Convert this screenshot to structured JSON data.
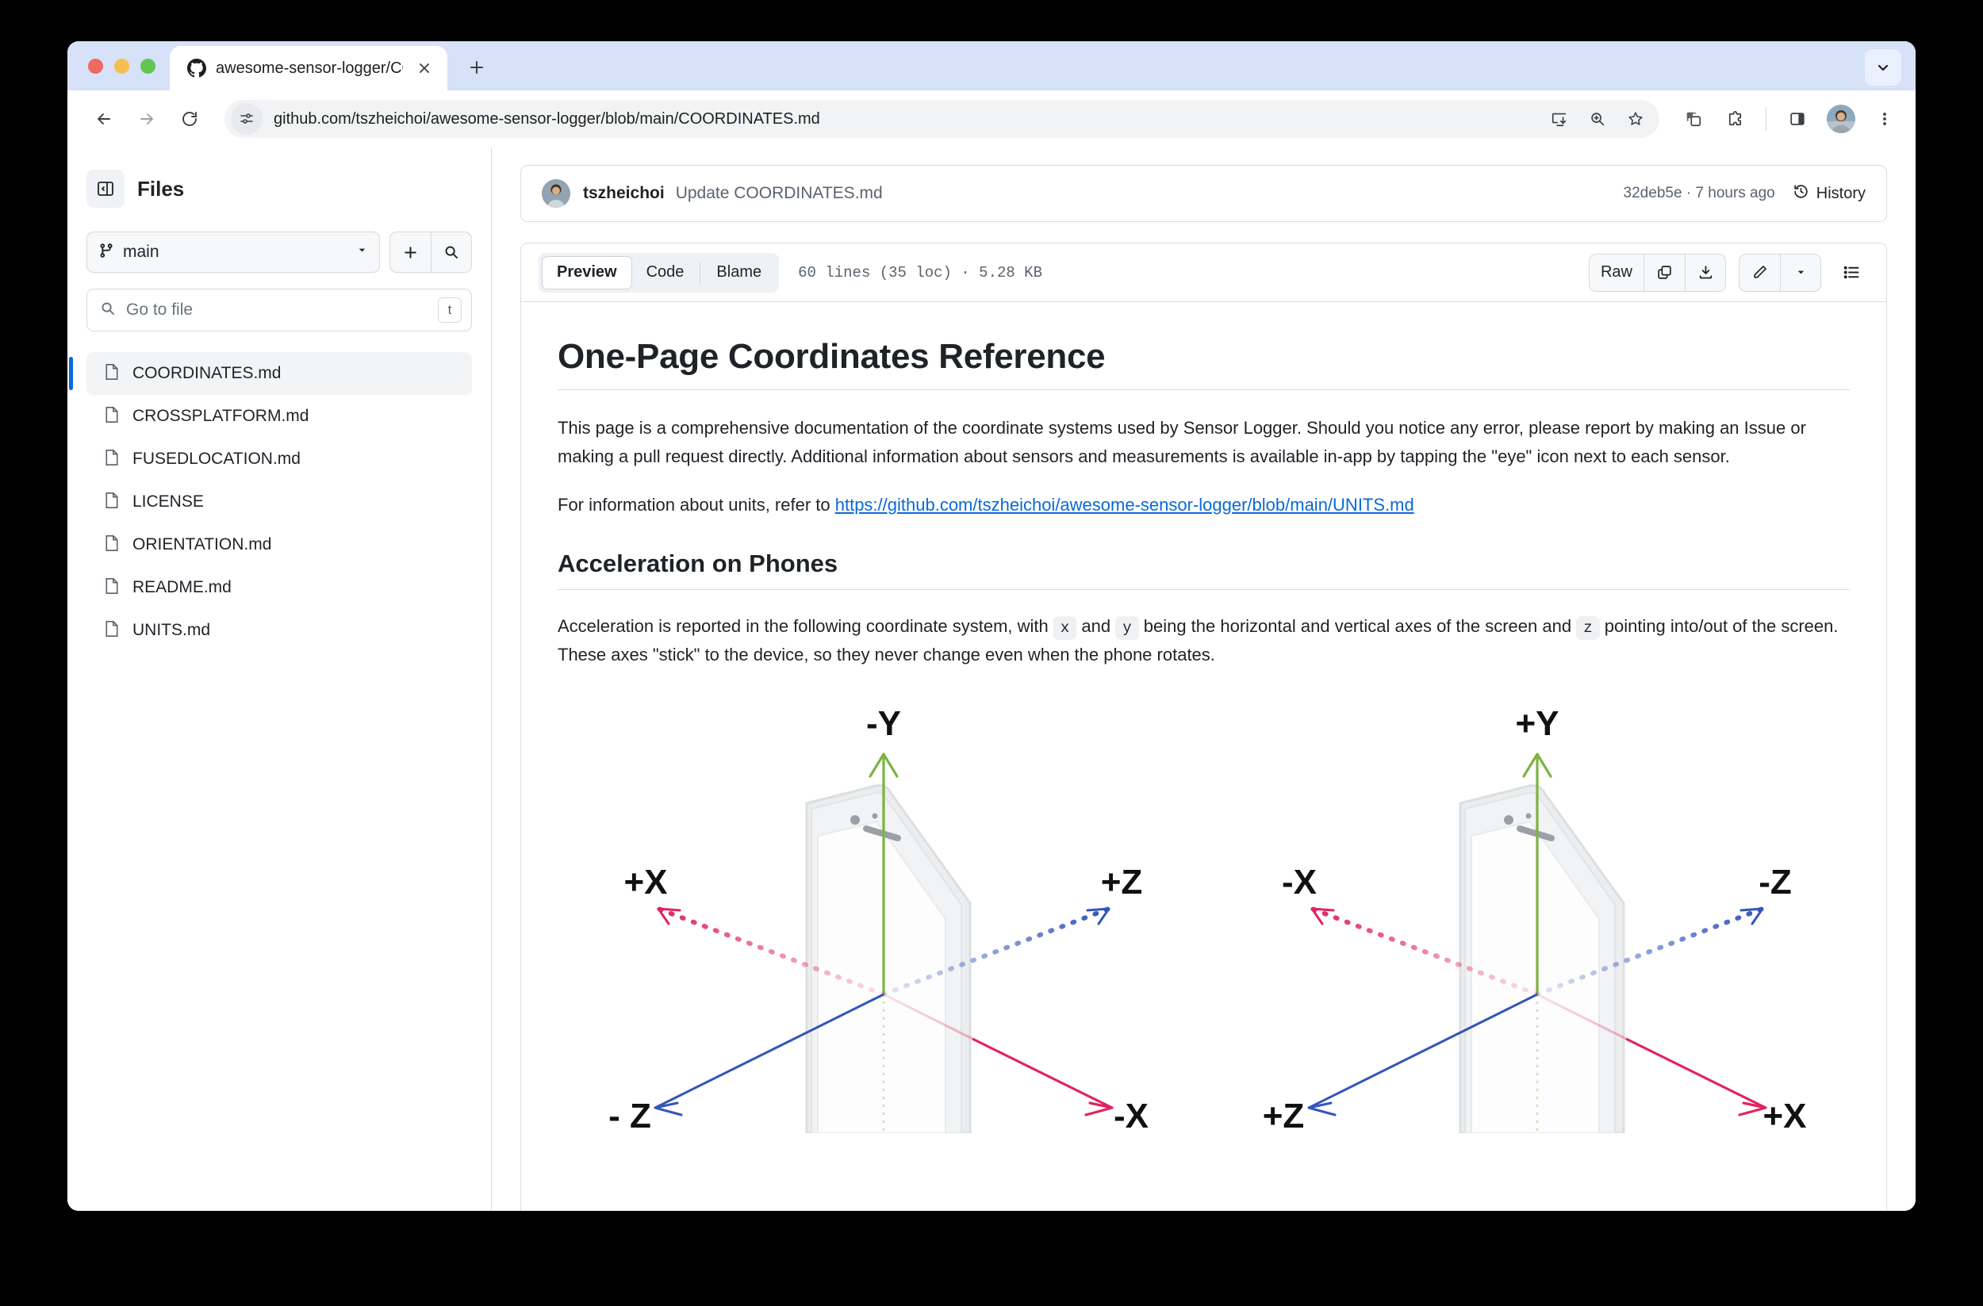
{
  "browser": {
    "tab": {
      "title": "awesome-sensor-logger/COO",
      "favicon_icon": "github-icon",
      "close_icon": "close-icon"
    },
    "new_tab_icon": "plus-icon",
    "tab_search_icon": "chevron-down-icon",
    "nav": {
      "back_icon": "back-arrow-icon",
      "forward_icon": "forward-arrow-icon",
      "reload_icon": "reload-icon"
    },
    "omnibox": {
      "url": "github.com/tszheichoi/awesome-sensor-logger/blob/main/COORDINATES.md",
      "site_info_icon": "page-settings-icon",
      "actions": [
        "install-app-icon",
        "zoom-icon",
        "bookmark-star-icon"
      ]
    },
    "toolbar_icons": [
      "tab-groups-icon",
      "extensions-puzzle-icon",
      "side-panel-icon",
      "avatar",
      "three-dot-menu-icon"
    ],
    "traffic_lights": [
      "close",
      "minimize",
      "maximize"
    ]
  },
  "sidebar": {
    "panel_toggle_icon": "sidebar-collapse-icon",
    "title": "Files",
    "branch": {
      "icon": "git-branch-icon",
      "name": "main",
      "caret_icon": "chevron-down-icon"
    },
    "add_icon": "plus-icon",
    "search_icon": "search-icon",
    "go_to_file": {
      "placeholder": "Go to file",
      "value": "",
      "search_icon": "search-icon",
      "shortcut": "t"
    },
    "files": [
      {
        "name": "COORDINATES.md",
        "selected": true
      },
      {
        "name": "CROSSPLATFORM.md",
        "selected": false
      },
      {
        "name": "FUSEDLOCATION.md",
        "selected": false
      },
      {
        "name": "LICENSE",
        "selected": false
      },
      {
        "name": "ORIENTATION.md",
        "selected": false
      },
      {
        "name": "README.md",
        "selected": false
      },
      {
        "name": "UNITS.md",
        "selected": false
      }
    ]
  },
  "commit_bar": {
    "author": "tszheichoi",
    "message": "Update COORDINATES.md",
    "meta": "32deb5e · 7 hours ago",
    "history_label": "History",
    "history_icon": "history-clock-icon"
  },
  "file_toolbar": {
    "tabs": [
      {
        "label": "Preview",
        "active": true
      },
      {
        "label": "Code",
        "active": false
      },
      {
        "label": "Blame",
        "active": false
      }
    ],
    "loc_info": "60 lines (35 loc) · 5.28 KB",
    "raw_label": "Raw",
    "copy_icon": "copy-icon",
    "download_icon": "download-icon",
    "edit_icon": "pencil-icon",
    "edit_caret_icon": "caret-down-icon",
    "outline_icon": "outline-list-icon"
  },
  "document": {
    "h1": "One-Page Coordinates Reference",
    "intro": "This page is a comprehensive documentation of the coordinate systems used by Sensor Logger. Should you notice any error, please report by making an Issue or making a pull request directly. Additional information about sensors and measurements is available in-app by tapping the \"eye\" icon next to each sensor.",
    "units_prefix": "For information about units, refer to ",
    "units_link": "https://github.com/tszheichoi/awesome-sensor-logger/blob/main/UNITS.md",
    "h2": "Acceleration on Phones",
    "accel_p1": "Acceleration is reported in the following coordinate system, with ",
    "code_x": "x",
    "accel_p2": " and ",
    "code_y": "y",
    "accel_p3": " being the horizontal and vertical axes of the screen and ",
    "code_z": "z",
    "accel_p4": " pointing into/out of the screen. These axes \"stick\" to the device, so they never change even when the phone rotates.",
    "figure": {
      "left": {
        "name": "phone-axes-diagram-left",
        "up": "-Y",
        "upper_left": "+X",
        "upper_right": "+Z",
        "lower_left": "- Z",
        "lower_right": "-X"
      },
      "right": {
        "name": "phone-axes-diagram-right",
        "up": "+Y",
        "upper_left": "-X",
        "upper_right": "-Z",
        "lower_left": "+Z",
        "lower_right": "+X"
      }
    }
  },
  "colors": {
    "accent_blue": "#0969da",
    "axis_green": "#7cb342",
    "axis_blue": "#3355bb",
    "axis_crimson": "#e0245e",
    "tabstrip": "#d7e1f8",
    "border": "#d8dee4"
  }
}
